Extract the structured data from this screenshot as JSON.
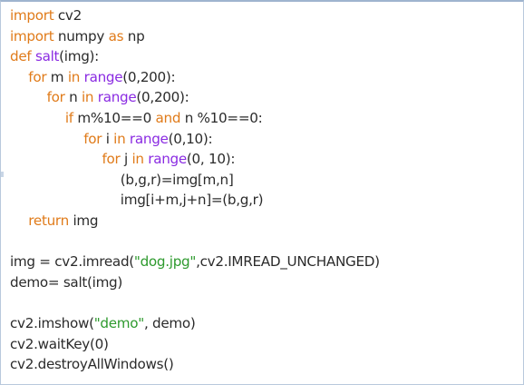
{
  "colors": {
    "keyword": "#e07b1a",
    "function": "#8a2be2",
    "string": "#2e9a2e",
    "text": "#2b2b2b"
  },
  "code": {
    "lines": [
      {
        "indent": 0,
        "tokens": [
          {
            "t": "import",
            "c": "keyword"
          },
          {
            "t": " cv2",
            "c": "text"
          }
        ]
      },
      {
        "indent": 0,
        "tokens": [
          {
            "t": "import",
            "c": "keyword"
          },
          {
            "t": " numpy ",
            "c": "text"
          },
          {
            "t": "as",
            "c": "keyword"
          },
          {
            "t": " np",
            "c": "text"
          }
        ]
      },
      {
        "indent": 0,
        "tokens": [
          {
            "t": "def",
            "c": "keyword"
          },
          {
            "t": " salt",
            "c": "function"
          },
          {
            "t": "(img):",
            "c": "text"
          }
        ]
      },
      {
        "indent": 1,
        "tokens": [
          {
            "t": "for",
            "c": "keyword"
          },
          {
            "t": " m ",
            "c": "text"
          },
          {
            "t": "in",
            "c": "keyword"
          },
          {
            "t": " range",
            "c": "function"
          },
          {
            "t": "(0,200):",
            "c": "text"
          }
        ]
      },
      {
        "indent": 2,
        "tokens": [
          {
            "t": "for",
            "c": "keyword"
          },
          {
            "t": " n ",
            "c": "text"
          },
          {
            "t": "in",
            "c": "keyword"
          },
          {
            "t": " range",
            "c": "function"
          },
          {
            "t": "(0,200):",
            "c": "text"
          }
        ]
      },
      {
        "indent": 3,
        "tokens": [
          {
            "t": "if",
            "c": "keyword"
          },
          {
            "t": " m%10==0 ",
            "c": "text"
          },
          {
            "t": "and",
            "c": "keyword"
          },
          {
            "t": " n %10==0:",
            "c": "text"
          }
        ]
      },
      {
        "indent": 4,
        "tokens": [
          {
            "t": "for",
            "c": "keyword"
          },
          {
            "t": " i ",
            "c": "text"
          },
          {
            "t": "in",
            "c": "keyword"
          },
          {
            "t": " range",
            "c": "function"
          },
          {
            "t": "(0,10):",
            "c": "text"
          }
        ]
      },
      {
        "indent": 5,
        "tokens": [
          {
            "t": "for",
            "c": "keyword"
          },
          {
            "t": " j ",
            "c": "text"
          },
          {
            "t": "in",
            "c": "keyword"
          },
          {
            "t": " range",
            "c": "function"
          },
          {
            "t": "(0, 10):",
            "c": "text"
          }
        ]
      },
      {
        "indent": 6,
        "tokens": [
          {
            "t": "(b,g,r)=img[m,n]",
            "c": "text"
          }
        ]
      },
      {
        "indent": 6,
        "tokens": [
          {
            "t": "img[i+m,j+n]=(b,g,r)",
            "c": "text"
          }
        ]
      },
      {
        "indent": 1,
        "tokens": [
          {
            "t": "return",
            "c": "keyword"
          },
          {
            "t": " img",
            "c": "text"
          }
        ]
      },
      {
        "indent": 0,
        "tokens": []
      },
      {
        "indent": 0,
        "tokens": [
          {
            "t": "img = cv2.imread(",
            "c": "text"
          },
          {
            "t": "\"dog.jpg\"",
            "c": "string"
          },
          {
            "t": ",cv2.IMREAD_UNCHANGED)",
            "c": "text"
          }
        ]
      },
      {
        "indent": 0,
        "tokens": [
          {
            "t": "demo= salt(img)",
            "c": "text"
          }
        ]
      },
      {
        "indent": 0,
        "tokens": []
      },
      {
        "indent": 0,
        "tokens": [
          {
            "t": "cv2.imshow(",
            "c": "text"
          },
          {
            "t": "\"demo\"",
            "c": "string"
          },
          {
            "t": ", demo)",
            "c": "text"
          }
        ]
      },
      {
        "indent": 0,
        "tokens": [
          {
            "t": "cv2.waitKey(0)",
            "c": "text"
          }
        ]
      },
      {
        "indent": 0,
        "tokens": [
          {
            "t": "cv2.destroyAllWindows()",
            "c": "text"
          }
        ]
      }
    ]
  }
}
